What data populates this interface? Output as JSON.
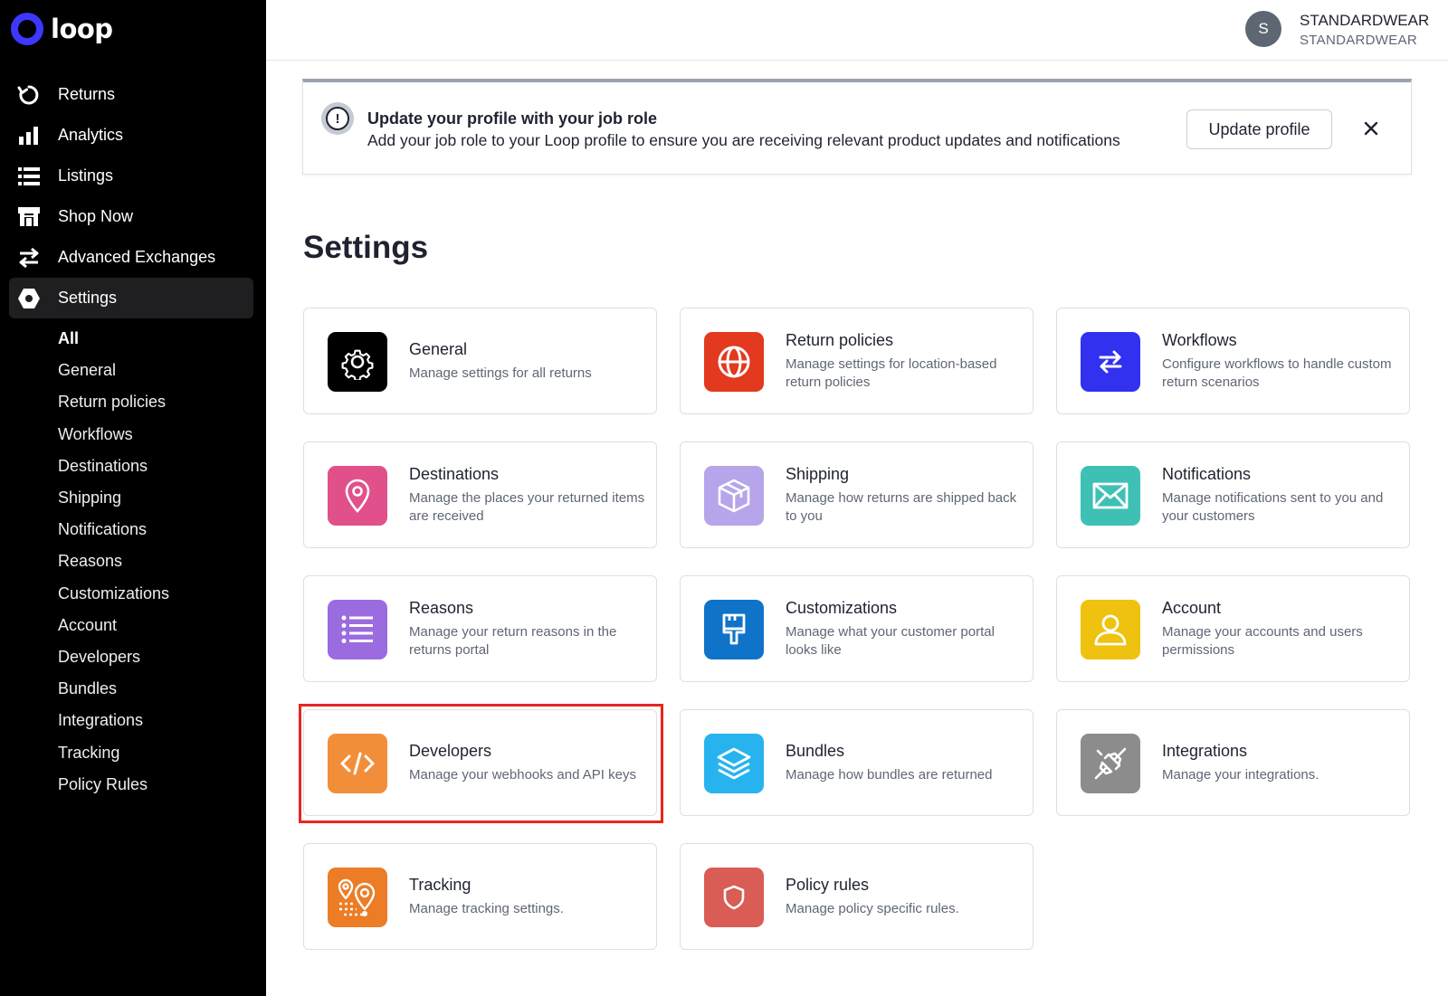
{
  "app": {
    "logo_text": "loop",
    "brand_color": "#3d37ff"
  },
  "sidebar": {
    "nav": [
      {
        "label": "Returns",
        "icon": "returns-icon"
      },
      {
        "label": "Analytics",
        "icon": "analytics-icon"
      },
      {
        "label": "Listings",
        "icon": "listings-icon"
      },
      {
        "label": "Shop Now",
        "icon": "shop-now-icon"
      },
      {
        "label": "Advanced Exchanges",
        "icon": "exchange-icon"
      },
      {
        "label": "Settings",
        "icon": "settings-hexagon-icon",
        "active": true
      }
    ],
    "subnav": [
      {
        "label": "All",
        "active": true
      },
      {
        "label": "General"
      },
      {
        "label": "Return policies"
      },
      {
        "label": "Workflows"
      },
      {
        "label": "Destinations"
      },
      {
        "label": "Shipping"
      },
      {
        "label": "Notifications"
      },
      {
        "label": "Reasons"
      },
      {
        "label": "Customizations"
      },
      {
        "label": "Account"
      },
      {
        "label": "Developers"
      },
      {
        "label": "Bundles"
      },
      {
        "label": "Integrations"
      },
      {
        "label": "Tracking"
      },
      {
        "label": "Policy Rules"
      }
    ]
  },
  "header": {
    "avatar_letter": "S",
    "user_name": "STANDARDWEAR",
    "user_store": "STANDARDWEAR"
  },
  "banner": {
    "icon": "info-icon",
    "title": "Update your profile with your job role",
    "text": "Add your job role to your Loop profile to ensure you are receiving relevant product updates and notifications",
    "button_label": "Update profile",
    "close_icon": "close-icon"
  },
  "page": {
    "title": "Settings"
  },
  "cards": [
    {
      "title": "General",
      "desc": "Manage settings for all returns",
      "icon": "gear-icon",
      "color": "#000000"
    },
    {
      "title": "Return policies",
      "desc": "Manage settings for location-based return policies",
      "icon": "globe-icon",
      "color": "#e2391f"
    },
    {
      "title": "Workflows",
      "desc": "Configure workflows to handle custom return scenarios",
      "icon": "arrows-swap-icon",
      "color": "#3131ef"
    },
    {
      "title": "Destinations",
      "desc": "Manage the places your returned items are received",
      "icon": "map-pin-icon",
      "color": "#e1508a"
    },
    {
      "title": "Shipping",
      "desc": "Manage how returns are shipped back to you",
      "icon": "box-icon",
      "color": "#b6a5ea"
    },
    {
      "title": "Notifications",
      "desc": "Manage notifications sent to you and your customers",
      "icon": "envelope-icon",
      "color": "#3fc0b4"
    },
    {
      "title": "Reasons",
      "desc": "Manage your return reasons in the returns portal",
      "icon": "list-icon",
      "color": "#9b6be0"
    },
    {
      "title": "Customizations",
      "desc": "Manage what your customer portal looks like",
      "icon": "paint-brush-icon",
      "color": "#0f73c9"
    },
    {
      "title": "Account",
      "desc": "Manage your accounts and users permissions",
      "icon": "user-icon",
      "color": "#eec20e"
    },
    {
      "title": "Developers",
      "desc": "Manage your webhooks and API keys",
      "icon": "code-icon",
      "color": "#f28e3a",
      "highlighted": true
    },
    {
      "title": "Bundles",
      "desc": "Manage how bundles are returned",
      "icon": "layers-icon",
      "color": "#27b4ee"
    },
    {
      "title": "Integrations",
      "desc": "Manage your integrations.",
      "icon": "plug-icon",
      "color": "#8c8c8c"
    },
    {
      "title": "Tracking",
      "desc": "Manage tracking settings.",
      "icon": "tracking-route-icon",
      "color": "#ec7d26"
    },
    {
      "title": "Policy rules",
      "desc": "Manage policy specific rules.",
      "icon": "shield-icon",
      "color": "#d95c55"
    }
  ]
}
